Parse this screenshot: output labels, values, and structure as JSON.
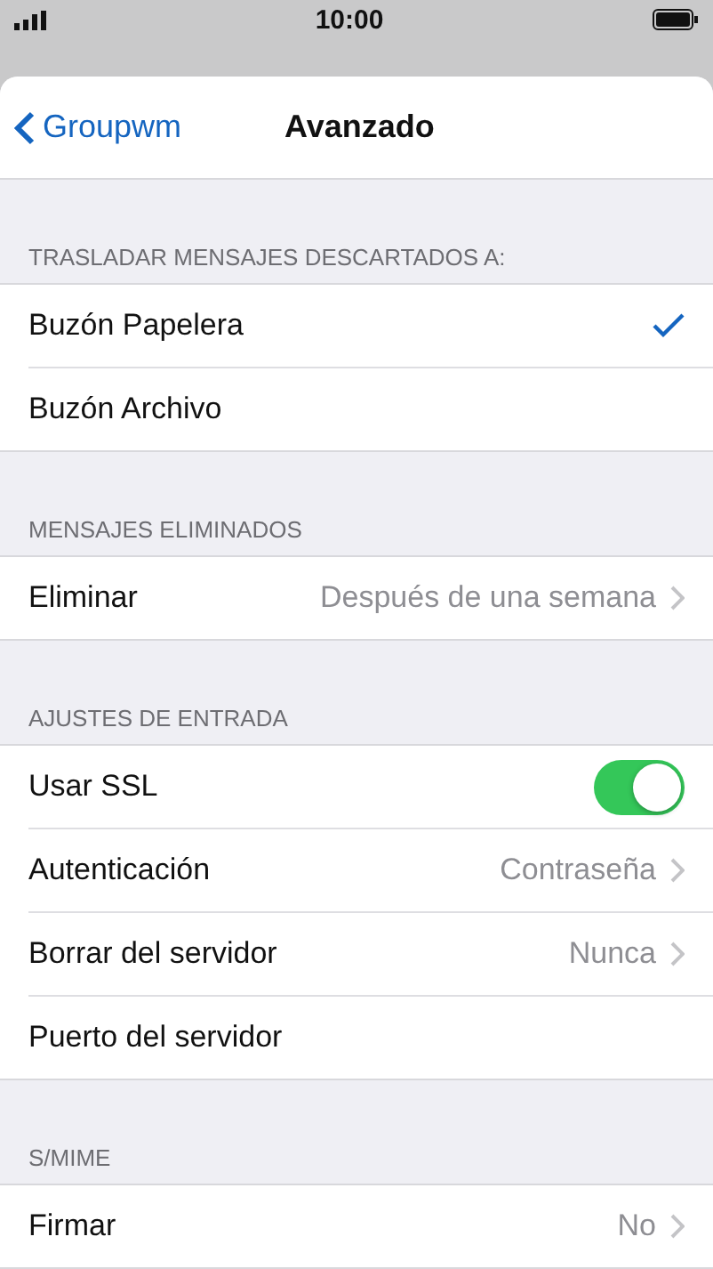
{
  "status_bar": {
    "time": "10:00"
  },
  "nav": {
    "back": "Groupwm",
    "title": "Avanzado"
  },
  "sections": [
    {
      "header": "TRASLADAR MENSAJES DESCARTADOS A:",
      "rows": [
        {
          "kind": "choice",
          "label": "Buzón Papelera",
          "selected": true
        },
        {
          "kind": "choice",
          "label": "Buzón Archivo",
          "selected": false
        }
      ]
    },
    {
      "header": "MENSAJES ELIMINADOS",
      "rows": [
        {
          "kind": "link",
          "label": "Eliminar",
          "value": "Después de una semana"
        }
      ]
    },
    {
      "header": "AJUSTES DE ENTRADA",
      "rows": [
        {
          "kind": "toggle",
          "label": "Usar SSL",
          "on": true
        },
        {
          "kind": "link",
          "label": "Autenticación",
          "value": "Contraseña"
        },
        {
          "kind": "link",
          "label": "Borrar del servidor",
          "value": "Nunca"
        },
        {
          "kind": "plain",
          "label": "Puerto del servidor"
        }
      ]
    },
    {
      "header": "S/MIME",
      "rows": [
        {
          "kind": "link",
          "label": "Firmar",
          "value": "No"
        }
      ]
    }
  ]
}
